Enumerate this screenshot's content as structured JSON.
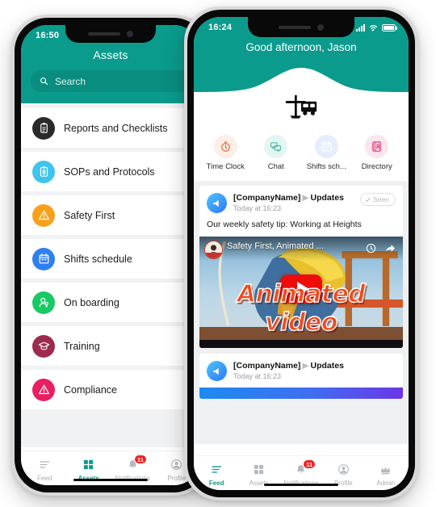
{
  "theme": {
    "teal": "#0a9b8c",
    "badge_red": "#f32020",
    "active_nav": "#0a9b8c"
  },
  "left_phone": {
    "status": {
      "time": "16:50"
    },
    "header": {
      "title": "Assets"
    },
    "search": {
      "placeholder": "Search",
      "icon": "search-icon"
    },
    "assets": [
      {
        "label": "Reports and Checklists",
        "icon": "clipboard-icon",
        "color": "#2b2b2b"
      },
      {
        "label": "SOPs and Protocols",
        "icon": "document-stack-icon",
        "color": "#3fc4f0"
      },
      {
        "label": "Safety First",
        "icon": "warning-triangle-icon",
        "color": "#f9a01b"
      },
      {
        "label": "Shifts schedule",
        "icon": "calendar-icon",
        "color": "#2f7ff0"
      },
      {
        "label": "On boarding",
        "icon": "user-key-icon",
        "color": "#18c964"
      },
      {
        "label": "Training",
        "icon": "graduation-cap-icon",
        "color": "#9e2b4e"
      },
      {
        "label": "Compliance",
        "icon": "alert-triangle-icon",
        "color": "#e91e63"
      }
    ],
    "nav": [
      {
        "label": "Feed",
        "icon": "feed-icon",
        "active": false,
        "badge": ""
      },
      {
        "label": "Assets",
        "icon": "grid-icon",
        "active": true,
        "badge": ""
      },
      {
        "label": "Notifications",
        "icon": "bell-icon",
        "active": false,
        "badge": "11"
      },
      {
        "label": "Profile",
        "icon": "user-circle-icon",
        "active": false,
        "badge": ""
      }
    ]
  },
  "right_phone": {
    "status": {
      "time": "16:24",
      "icons": [
        "signal-icon",
        "wifi-icon",
        "battery-icon"
      ]
    },
    "header": {
      "greeting": "Good afternoon, Jason",
      "logo": "plane-truck-logo"
    },
    "quick_actions": [
      {
        "label": "Time Clock",
        "icon": "stopwatch-icon",
        "color": "#f0693a",
        "bg": "#fdeee8"
      },
      {
        "label": "Chat",
        "icon": "chat-bubbles-icon",
        "color": "#4bbfae",
        "bg": "#e5f5f2"
      },
      {
        "label": "Shifts sch...",
        "icon": "calendar-icon",
        "color": "#3d8ef5",
        "bg": "#e6eefd"
      },
      {
        "label": "Directory",
        "icon": "contact-book-icon",
        "color": "#e03a73",
        "bg": "#fbe6ee"
      }
    ],
    "posts": [
      {
        "company": "[CompanyName]",
        "separator": "▶",
        "channel": "Updates",
        "time": "Today at 16:23",
        "seen_label": "Seen",
        "body": "Our weekly safety tip: Working at Heights",
        "video": {
          "title": "Safety First, Animated ...",
          "caption": "Animated video",
          "play_icon": "youtube-play-icon",
          "actions": [
            "watch-later-icon",
            "share-icon"
          ]
        }
      },
      {
        "company": "[CompanyName]",
        "separator": "▶",
        "channel": "Updates",
        "time": "Today at 16:23"
      }
    ],
    "nav": [
      {
        "label": "Feed",
        "icon": "feed-icon",
        "active": true,
        "badge": ""
      },
      {
        "label": "Assets",
        "icon": "grid-icon",
        "active": false,
        "badge": ""
      },
      {
        "label": "Notifications",
        "icon": "bell-icon",
        "active": false,
        "badge": "11"
      },
      {
        "label": "Profile",
        "icon": "user-circle-icon",
        "active": false,
        "badge": ""
      },
      {
        "label": "Admin",
        "icon": "crown-icon",
        "active": false,
        "badge": ""
      }
    ]
  }
}
